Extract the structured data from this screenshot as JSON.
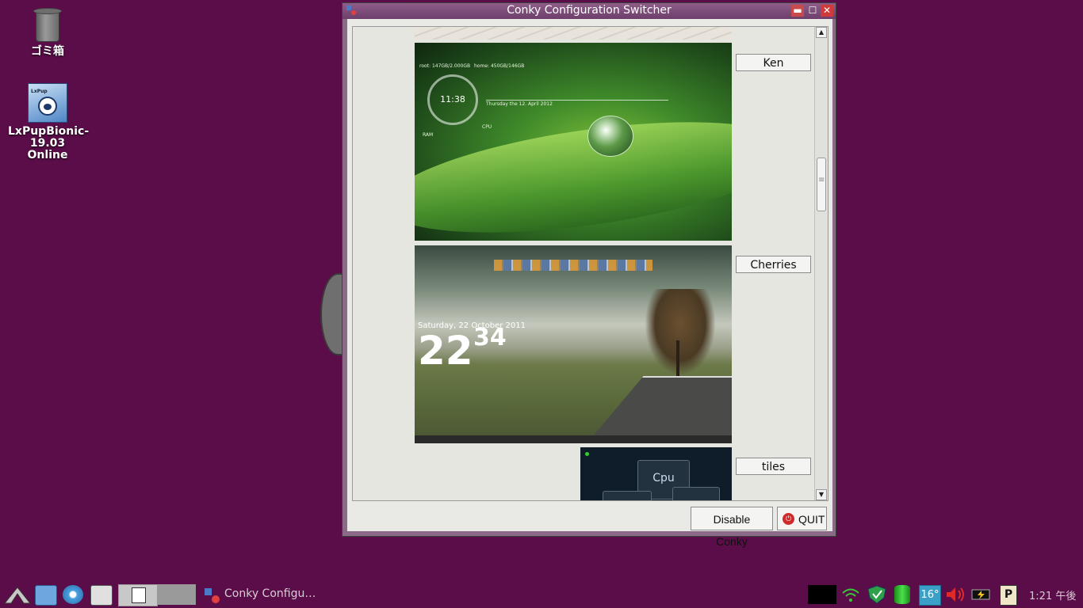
{
  "desktop": {
    "trash_label": "ゴミ箱",
    "lxpup_label_line1": "LxPupBionic-",
    "lxpup_label_line2": "19.03 Online",
    "lxpup_logo_tag": "LxPup"
  },
  "window": {
    "title": "Conky Configuration Switcher",
    "min_glyph": "▬",
    "max_glyph": "☐",
    "close_glyph": "✕"
  },
  "themes": [
    {
      "name": "Ken"
    },
    {
      "name": "Cherries"
    },
    {
      "name": "tiles"
    }
  ],
  "ken_preview": {
    "time": "11:38",
    "root": "root: 147GB/2.000GB",
    "home": "home: 450GB/146GB",
    "date": "Thursday the 12. April 2012",
    "ram": "RAM",
    "cpu": "CPU"
  },
  "cherries_preview": {
    "date": "Saturday, 22 October 2011",
    "hour": "22",
    "minute": "34"
  },
  "tiles_preview": {
    "tile_label": "Cpu"
  },
  "buttons": {
    "disable": "Disable Conky",
    "quit": "QUIT"
  },
  "taskbar": {
    "task_label": "Conky Configu…",
    "temperature": "16°",
    "clock": "1:21 午後"
  },
  "colors": {
    "desktop": "#5a0d48",
    "titlebar": "#7a4a76"
  }
}
